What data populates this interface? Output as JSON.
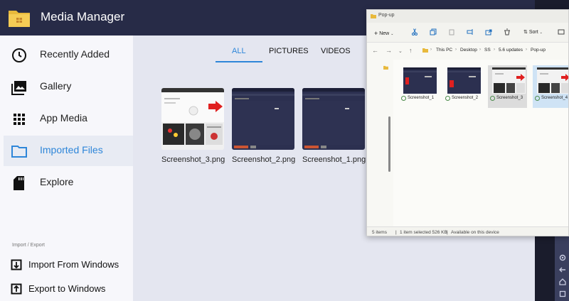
{
  "app": {
    "title": "Media Manager",
    "accent": "#2e86d9",
    "header_bg": "#272b47"
  },
  "sidebar": {
    "items": [
      {
        "label": "Recently Added",
        "icon": "clock-icon",
        "active": false
      },
      {
        "label": "Gallery",
        "icon": "gallery-icon",
        "active": false
      },
      {
        "label": "App Media",
        "icon": "grid-icon",
        "active": false
      },
      {
        "label": "Imported Files",
        "icon": "folder-icon",
        "active": true
      },
      {
        "label": "Explore",
        "icon": "sd-card-icon",
        "active": false
      }
    ],
    "section_label": "Import / Export",
    "actions": [
      {
        "label": "Import From Windows",
        "icon": "import-icon"
      },
      {
        "label": "Export to Windows",
        "icon": "export-icon"
      }
    ]
  },
  "tabs": [
    {
      "label": "ALL",
      "active": true
    },
    {
      "label": "PICTURES",
      "active": false
    },
    {
      "label": "VIDEOS",
      "active": false
    }
  ],
  "files": [
    {
      "name": "Screenshot_3.png"
    },
    {
      "name": "Screenshot_2.png"
    },
    {
      "name": "Screenshot_1.png"
    }
  ],
  "explorer": {
    "title": "Pop-up",
    "toolbar": {
      "new_label": "New",
      "sort_label": "Sort"
    },
    "breadcrumb": [
      "This PC",
      "Desktop",
      "SS",
      "5.6 updates",
      "Pop-up"
    ],
    "files": [
      {
        "name": "Screenshot_1",
        "state": "normal"
      },
      {
        "name": "Screenshot_2",
        "state": "normal"
      },
      {
        "name": "Screenshot_3",
        "state": "hovered"
      },
      {
        "name": "Screenshot_4",
        "state": "selected"
      }
    ],
    "status": {
      "count": "5 items",
      "selection": "1 item selected  526 KB",
      "availability": "Available on this device"
    }
  }
}
